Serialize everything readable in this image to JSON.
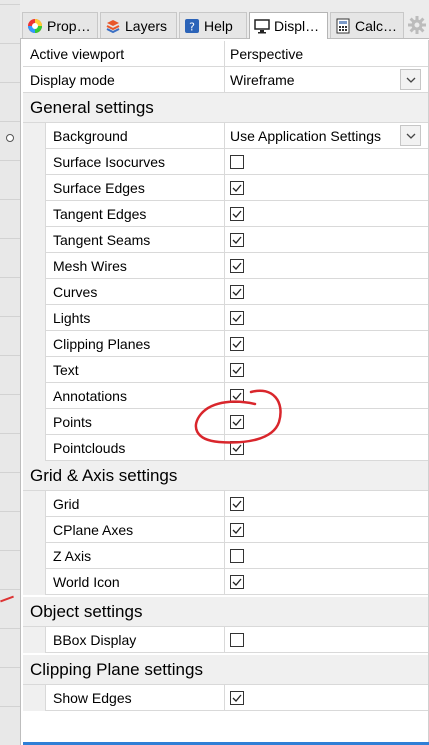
{
  "tabs": [
    {
      "label": "Prop…",
      "icon": "color-wheel-icon",
      "active": false
    },
    {
      "label": "Layers",
      "icon": "layers-icon",
      "active": false
    },
    {
      "label": "Help",
      "icon": "help-icon",
      "active": false
    },
    {
      "label": "Displ…",
      "icon": "monitor-icon",
      "active": true
    },
    {
      "label": "Calc…",
      "icon": "calculator-icon",
      "active": false
    }
  ],
  "settings_icon": "gear-icon",
  "top": {
    "active_viewport": {
      "label": "Active viewport",
      "value": "Perspective"
    },
    "display_mode": {
      "label": "Display mode",
      "value": "Wireframe"
    }
  },
  "general": {
    "title": "General settings",
    "background": {
      "label": "Background",
      "value": "Use Application Settings"
    },
    "items": [
      {
        "label": "Surface Isocurves",
        "checked": false
      },
      {
        "label": "Surface Edges",
        "checked": true
      },
      {
        "label": "Tangent Edges",
        "checked": true
      },
      {
        "label": "Tangent Seams",
        "checked": true
      },
      {
        "label": "Mesh Wires",
        "checked": true
      },
      {
        "label": "Curves",
        "checked": true
      },
      {
        "label": "Lights",
        "checked": true
      },
      {
        "label": "Clipping Planes",
        "checked": true
      },
      {
        "label": "Text",
        "checked": true
      },
      {
        "label": "Annotations",
        "checked": true
      },
      {
        "label": "Points",
        "checked": true
      },
      {
        "label": "Pointclouds",
        "checked": true
      }
    ]
  },
  "grid": {
    "title": "Grid & Axis settings",
    "items": [
      {
        "label": "Grid",
        "checked": true
      },
      {
        "label": "CPlane Axes",
        "checked": true
      },
      {
        "label": "Z Axis",
        "checked": false
      },
      {
        "label": "World Icon",
        "checked": true
      }
    ]
  },
  "object": {
    "title": "Object settings",
    "items": [
      {
        "label": "BBox Display",
        "checked": false
      }
    ]
  },
  "clipping": {
    "title": "Clipping Plane settings",
    "items": [
      {
        "label": "Show Edges",
        "checked": true
      }
    ]
  },
  "colors": {
    "annotation_circle": "#d9262c",
    "accent_bar": "#2f7fd6"
  }
}
